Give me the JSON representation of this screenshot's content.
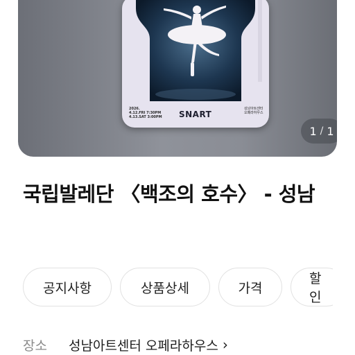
{
  "banner": {
    "poster": {
      "date_text": "2026.\n4.12.FRI 7:30PM\n4.13.SAT 3:00PM",
      "logo": "SNART",
      "venue_text": "성남아트센터\n오페라하우스"
    },
    "counter": {
      "current": "1",
      "total": "1"
    }
  },
  "title": "국립발레단 〈백조의 호수〉 - 성남",
  "tabs": [
    {
      "label": "공지사항"
    },
    {
      "label": "상품상세"
    },
    {
      "label": "가격"
    },
    {
      "label": "할인"
    }
  ],
  "info": {
    "venue_label": "장소",
    "venue_value": "성남아트센터 오페라하우스",
    "chevron_icon": "chevron-right-icon"
  }
}
